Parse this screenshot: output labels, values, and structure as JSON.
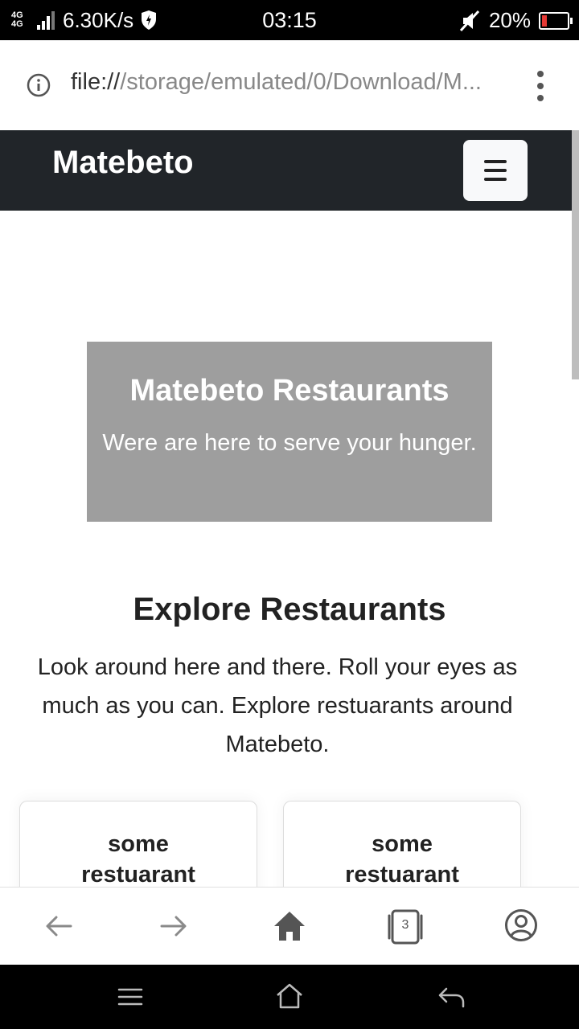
{
  "status_bar": {
    "network": "4G 4G",
    "speed": "6.30K/s",
    "time": "03:15",
    "battery_percent": "20%",
    "battery_level": 0.2,
    "battery_color": "#e53935",
    "icons": [
      "signal-icon",
      "shield-icon",
      "mute-icon",
      "battery-icon"
    ]
  },
  "browser": {
    "url_scheme": "file://",
    "url_rest": "/storage/emulated/0/Download/M...",
    "icons": [
      "info-icon",
      "more-menu-icon"
    ],
    "tab_count": "3",
    "bottom_icons": [
      "back-arrow-icon",
      "forward-arrow-icon",
      "home-icon",
      "tabs-icon",
      "profile-icon"
    ]
  },
  "navbar": {
    "brand": "Matebeto",
    "toggle_icon": "hamburger-icon",
    "bg_color": "#212529"
  },
  "hero": {
    "title": "Matebeto Restaurants",
    "subtitle": "Were are here to serve your hunger.",
    "bg_color": "#9e9e9e"
  },
  "explore": {
    "title": "Explore Restaurants",
    "text": "Look around here and there. Roll your eyes as much as you can. Explore restuarants around Matebeto."
  },
  "cards": [
    {
      "title": "some restuarant"
    },
    {
      "title": "some restuarant"
    }
  ],
  "system_nav": {
    "icons": [
      "menu-icon",
      "home-outline-icon",
      "back-icon"
    ]
  }
}
